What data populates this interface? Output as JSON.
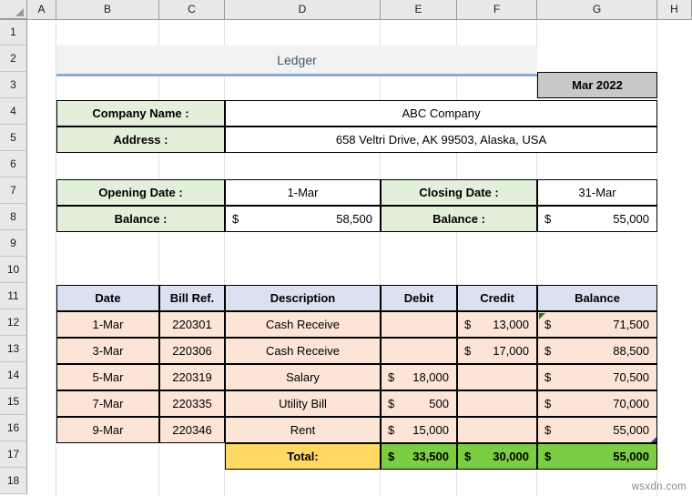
{
  "spreadsheet": {
    "column_headers": [
      "A",
      "B",
      "C",
      "D",
      "E",
      "F",
      "G",
      "H"
    ],
    "row_headers": [
      "1",
      "2",
      "3",
      "4",
      "5",
      "6",
      "7",
      "8",
      "9",
      "10",
      "11",
      "12",
      "13",
      "14",
      "15",
      "16",
      "17",
      "18"
    ],
    "watermark": "wsxdn.com"
  },
  "title_block": {
    "title": "Ledger",
    "period_badge": "Mar 2022"
  },
  "company_block": {
    "name_label": "Company Name :",
    "name_value": "ABC Company",
    "address_label": "Address :",
    "address_value": "658 Veltri Drive, AK 99503, Alaska, USA"
  },
  "period_block": {
    "opening_date_label": "Opening Date :",
    "opening_date_value": "1-Mar",
    "closing_date_label": "Closing Date :",
    "closing_date_value": "31-Mar",
    "opening_balance_label": "Balance :",
    "opening_balance_symbol": "$",
    "opening_balance_value": "58,500",
    "closing_balance_label": "Balance :",
    "closing_balance_symbol": "$",
    "closing_balance_value": "55,000"
  },
  "ledger_table": {
    "headers": [
      "Date",
      "Bill Ref.",
      "Description",
      "Debit",
      "Credit",
      "Balance"
    ],
    "rows": [
      {
        "date": "1-Mar",
        "bill_ref": "220301",
        "description": "Cash Receive",
        "debit_symbol": "",
        "debit": "",
        "credit_symbol": "$",
        "credit": "13,000",
        "balance_symbol": "$",
        "balance": "71,500"
      },
      {
        "date": "3-Mar",
        "bill_ref": "220306",
        "description": "Cash Receive",
        "debit_symbol": "",
        "debit": "",
        "credit_symbol": "$",
        "credit": "17,000",
        "balance_symbol": "$",
        "balance": "88,500"
      },
      {
        "date": "5-Mar",
        "bill_ref": "220319",
        "description": "Salary",
        "debit_symbol": "$",
        "debit": "18,000",
        "credit_symbol": "",
        "credit": "",
        "balance_symbol": "$",
        "balance": "70,500"
      },
      {
        "date": "7-Mar",
        "bill_ref": "220335",
        "description": "Utility Bill",
        "debit_symbol": "$",
        "debit": "500",
        "credit_symbol": "",
        "credit": "",
        "balance_symbol": "$",
        "balance": "70,000"
      },
      {
        "date": "9-Mar",
        "bill_ref": "220346",
        "description": "Rent",
        "debit_symbol": "$",
        "debit": "15,000",
        "credit_symbol": "",
        "credit": "",
        "balance_symbol": "$",
        "balance": "55,000"
      }
    ],
    "total": {
      "label": "Total:",
      "debit_symbol": "$",
      "debit": "33,500",
      "credit_symbol": "$",
      "credit": "30,000",
      "balance_symbol": "$",
      "balance": "55,000"
    }
  },
  "colors": {
    "title_text": "#44546a",
    "title_bg": "#f2f2f2",
    "title_underline": "#8ea9db",
    "badge_bg": "#c9c9c9",
    "label_green": "#e2efda",
    "table_header": "#dce1f2",
    "table_row": "#fce4d6",
    "total_label": "#ffd964",
    "total_value": "#7bcd44"
  }
}
